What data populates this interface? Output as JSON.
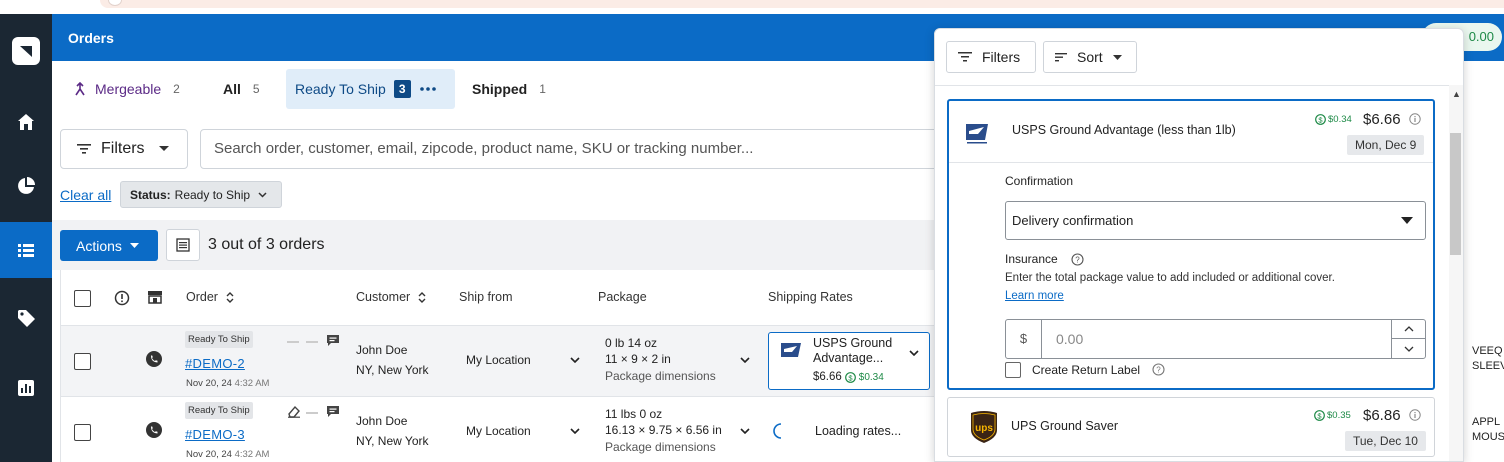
{
  "header": {
    "title": "Orders",
    "balance": "0.00"
  },
  "sidebar": {
    "items": [
      "home",
      "dashboard",
      "orders",
      "products",
      "reports"
    ]
  },
  "tabs": [
    {
      "label": "Mergeable",
      "count": "2"
    },
    {
      "label": "All",
      "count": "5"
    },
    {
      "label": "Ready To Ship",
      "count": "3"
    },
    {
      "label": "Shipped",
      "count": "1"
    }
  ],
  "filters": {
    "button_label": "Filters",
    "search_placeholder": "Search order, customer, email, zipcode, product name, SKU or tracking number..."
  },
  "chips": {
    "clear_all": "Clear all",
    "status_key": "Status:",
    "status_value": "Ready to Ship"
  },
  "toolbar": {
    "actions_label": "Actions",
    "count_text": "3 out of 3 orders"
  },
  "table": {
    "headers": {
      "order": "Order",
      "customer": "Customer",
      "ship_from": "Ship from",
      "package": "Package",
      "shipping_rates": "Shipping Rates"
    },
    "rows": [
      {
        "status": "Ready To Ship",
        "order": "#DEMO-2",
        "date": "Nov 20, 24",
        "time": "4:32 AM",
        "customer": "John Doe",
        "city": "NY, New York",
        "ship_from": "My Location",
        "weight": "0 lb 14 oz",
        "dims": "11 × 9 × 2 in",
        "pkg_label": "Package dimensions",
        "rate_name_1": "USPS Ground",
        "rate_name_2": "Advantage...",
        "rate_price": "$6.66",
        "rate_rebate": "$0.34",
        "right_1": "VEEQ",
        "right_2": "SLEEV"
      },
      {
        "status": "Ready To Ship",
        "order": "#DEMO-3",
        "date": "Nov 20, 24",
        "time": "4:32 AM",
        "customer": "John Doe",
        "city": "NY, New York",
        "ship_from": "My Location",
        "weight": "11 lbs 0 oz",
        "dims": "16.13 × 9.75 × 6.56 in",
        "pkg_label": "Package dimensions",
        "loading": "Loading rates...",
        "right_1": "APPL",
        "right_2": "MOUS"
      }
    ]
  },
  "panel": {
    "filters_label": "Filters",
    "sort_label": "Sort",
    "rate1": {
      "name": "USPS Ground Advantage (less than 1lb)",
      "rebate": "$0.34",
      "price": "$6.66",
      "date": "Mon, Dec 9",
      "confirmation_label": "Confirmation",
      "confirmation_value": "Delivery confirmation",
      "insurance_label": "Insurance",
      "insurance_help": "Enter the total package value to add included or additional cover.",
      "learn_more": "Learn more",
      "currency": "$",
      "amount_placeholder": "0.00",
      "return_label": "Create Return Label"
    },
    "rate2": {
      "name": "UPS Ground Saver",
      "rebate": "$0.35",
      "price": "$6.86",
      "date": "Tue, Dec 10",
      "logo_text": "ups"
    }
  },
  "colors": {
    "brand": "#0b6bc6",
    "sidebar": "#1b2733",
    "rebate_green": "#1e8a47",
    "mergeable_purple": "#5b2a86"
  }
}
